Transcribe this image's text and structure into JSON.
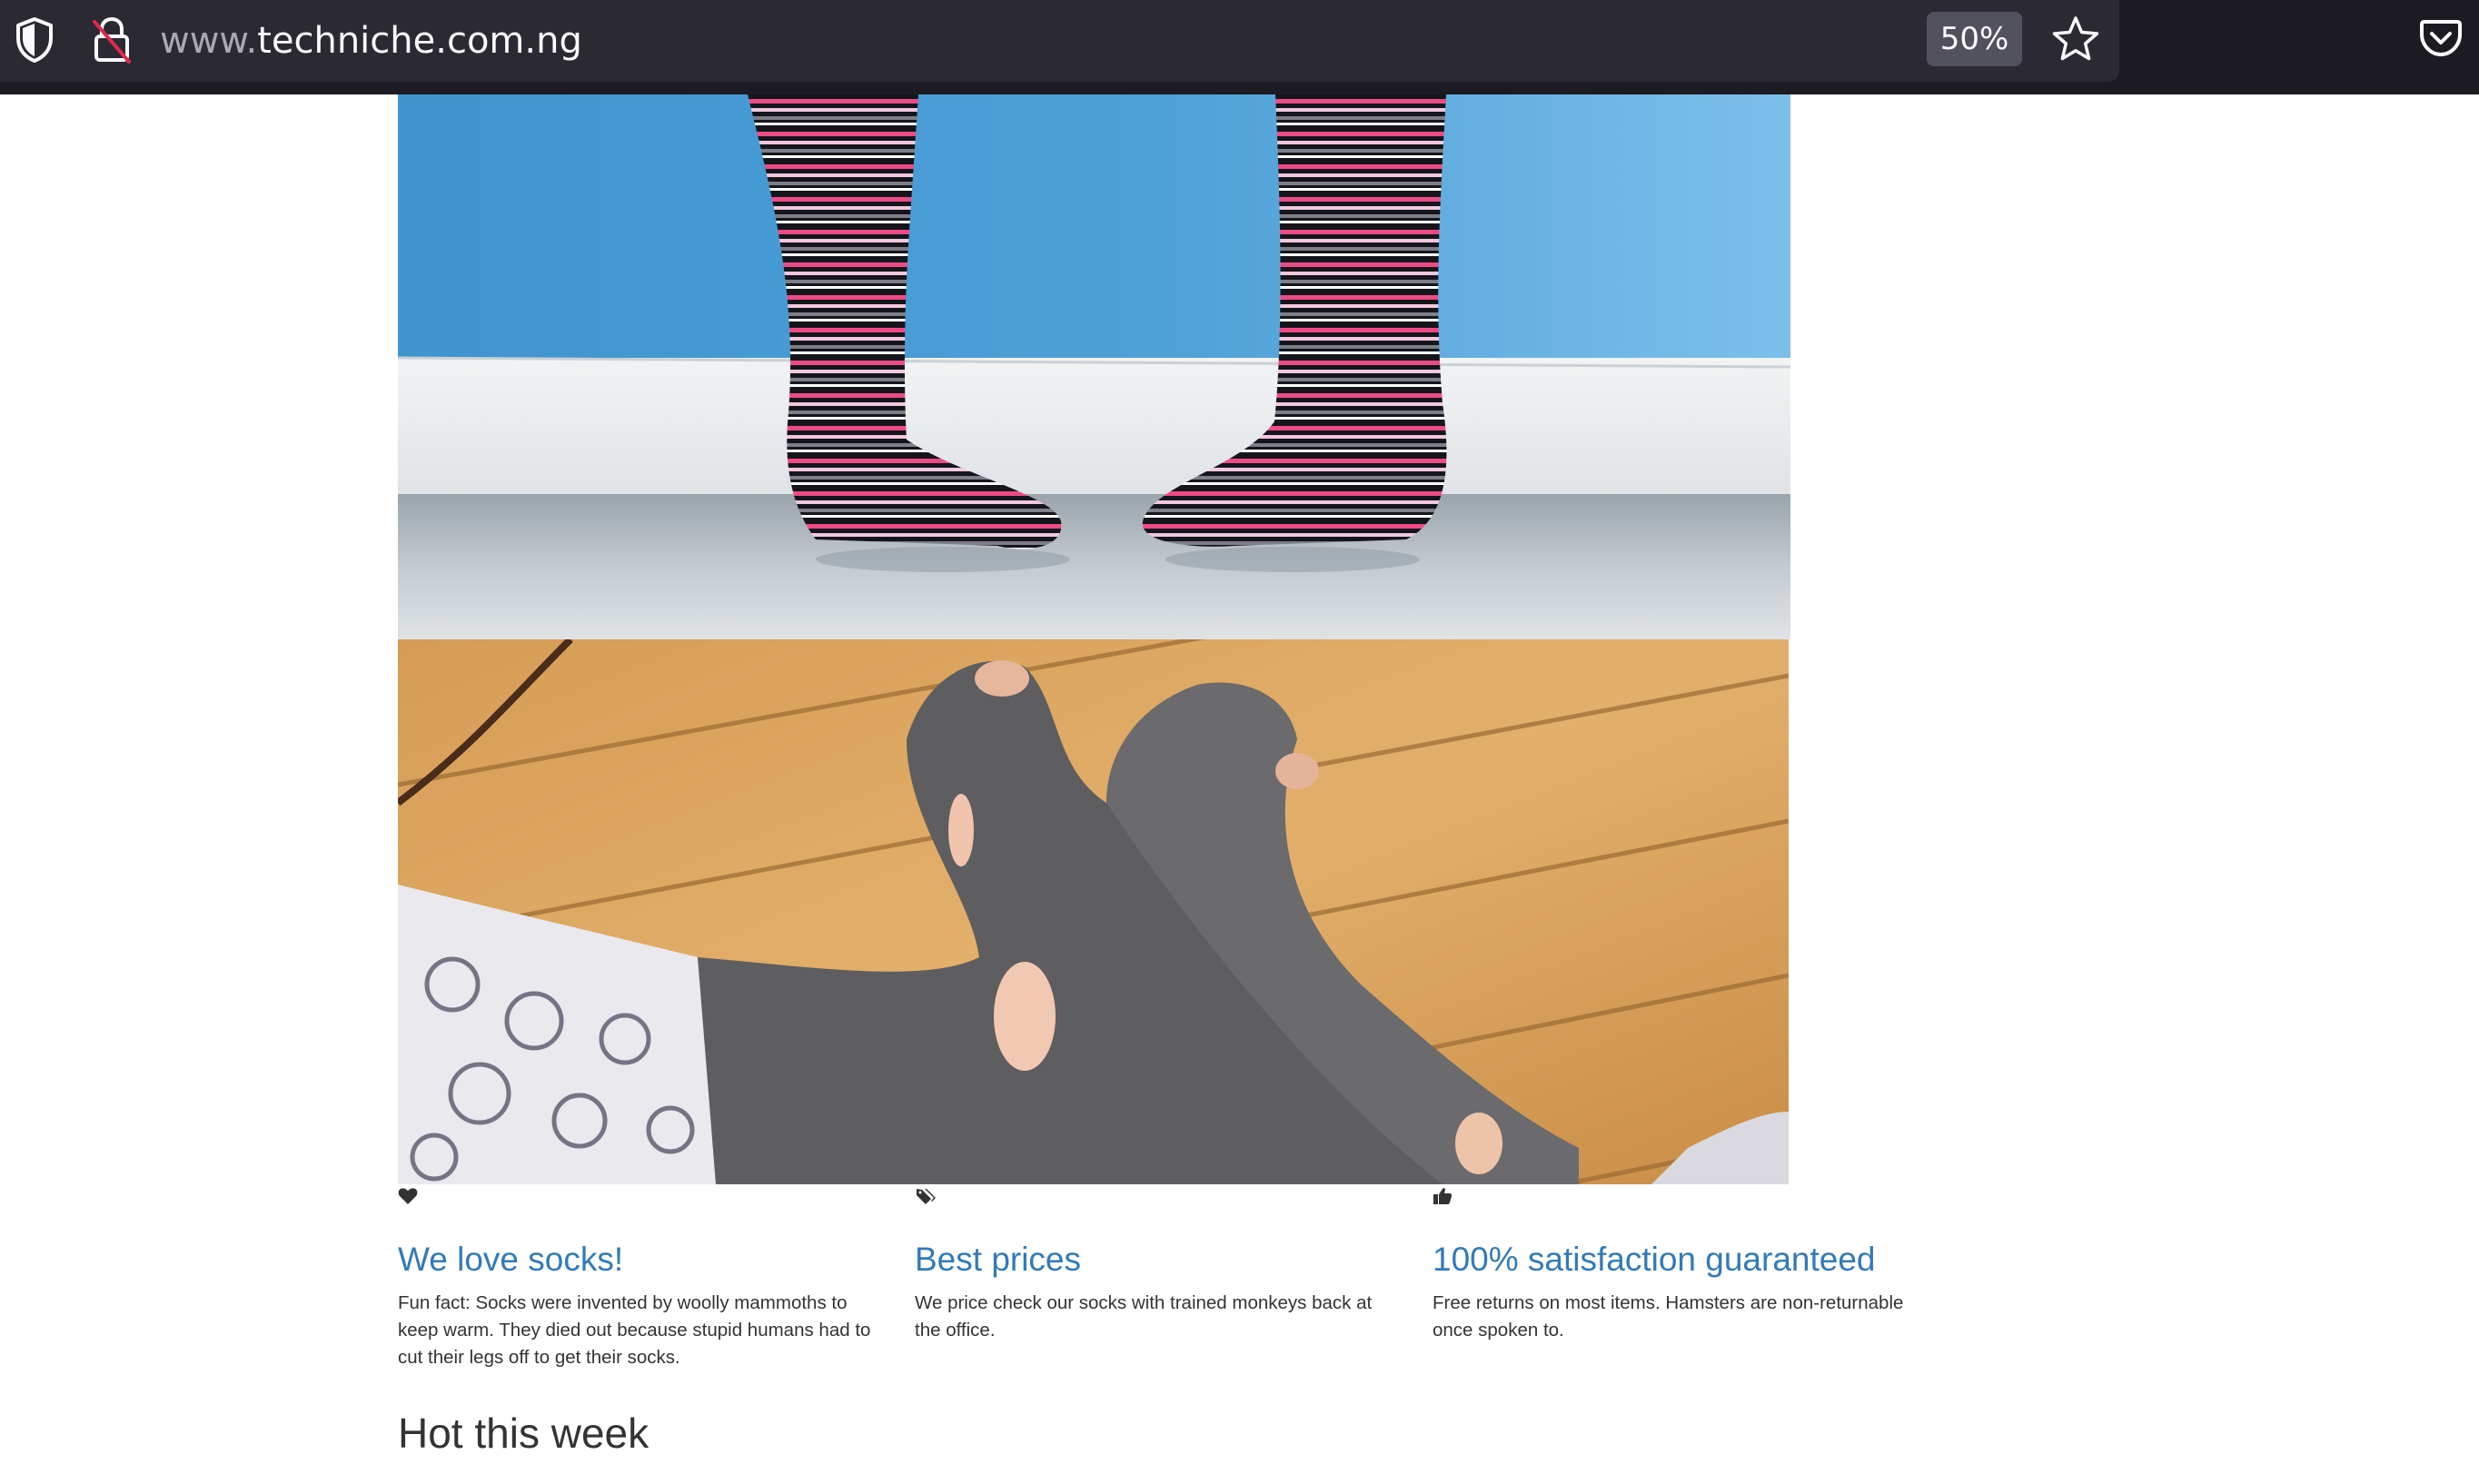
{
  "browser": {
    "url_prefix": "www.",
    "url_domain": "techniche.com.ng",
    "zoom": "50%",
    "icons": [
      "shield-icon",
      "insecure-lock-icon",
      "star-icon",
      "pocket-icon"
    ],
    "colors": {
      "toolbar": "#1c1b22",
      "urlbar": "#2b2a33",
      "text": "#fbfbfe"
    }
  },
  "carousel": {
    "slides": [
      {
        "name": "striped-socks-photo"
      },
      {
        "name": "holey-grey-socks-photo"
      }
    ]
  },
  "features": [
    {
      "icon": "heart-icon",
      "title": "We love socks!",
      "text": "Fun fact: Socks were invented by woolly mammoths to keep warm. They died out because stupid humans had to cut their legs off to get their socks."
    },
    {
      "icon": "tags-icon",
      "title": "Best prices",
      "text": "We price check our socks with trained monkeys back at the office."
    },
    {
      "icon": "thumbs-up-icon",
      "title": "100% satisfaction guaranteed",
      "text": "Free returns on most items. Hamsters are non-returnable once spoken to."
    }
  ],
  "hot": {
    "heading": "Hot this week"
  },
  "colors": {
    "link": "#337ab7",
    "text": "#333333",
    "background": "#ffffff"
  }
}
